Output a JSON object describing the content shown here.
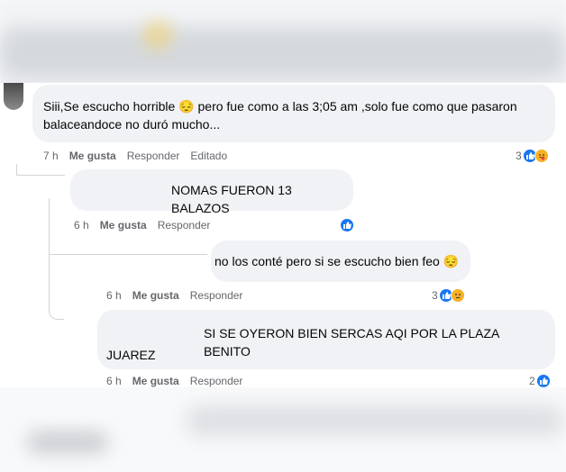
{
  "comments": [
    {
      "text_lines": [
        "Siii,Se escucho horrible 😔 pero fue como a las 3;05 am ,solo fue como que pasaron",
        "balaceandoce no duró mucho..."
      ],
      "time": "7 h",
      "like_label": "Me gusta",
      "reply_label": "Responder",
      "edited_label": "Editado",
      "reaction_count": "3",
      "reactions": [
        "like-icon",
        "care-icon"
      ]
    },
    {
      "text_lines": [
        "NOMAS FUERON 13 BALAZOS"
      ],
      "time": "6 h",
      "like_label": "Me gusta",
      "reply_label": "Responder",
      "reaction_count": "",
      "reactions": [
        "like-icon"
      ]
    },
    {
      "text_lines": [
        "no los conté pero si se escucho bien feo 😔"
      ],
      "time": "6 h",
      "like_label": "Me gusta",
      "reply_label": "Responder",
      "reaction_count": "3",
      "reactions": [
        "like-icon",
        "sad-icon"
      ]
    },
    {
      "text_lines": [
        "SI SE OYERON BIEN SERCAS AQI POR LA PLAZA BENITO",
        "JUAREZ"
      ],
      "time": "6 h",
      "like_label": "Me gusta",
      "reply_label": "Responder",
      "reaction_count": "2",
      "reactions": [
        "like-icon"
      ]
    }
  ],
  "colors": {
    "bubble": "#f0f2f5",
    "meta_text": "#65676b",
    "like_blue": "#1877f2",
    "reaction_yellow": "#f7b125"
  }
}
